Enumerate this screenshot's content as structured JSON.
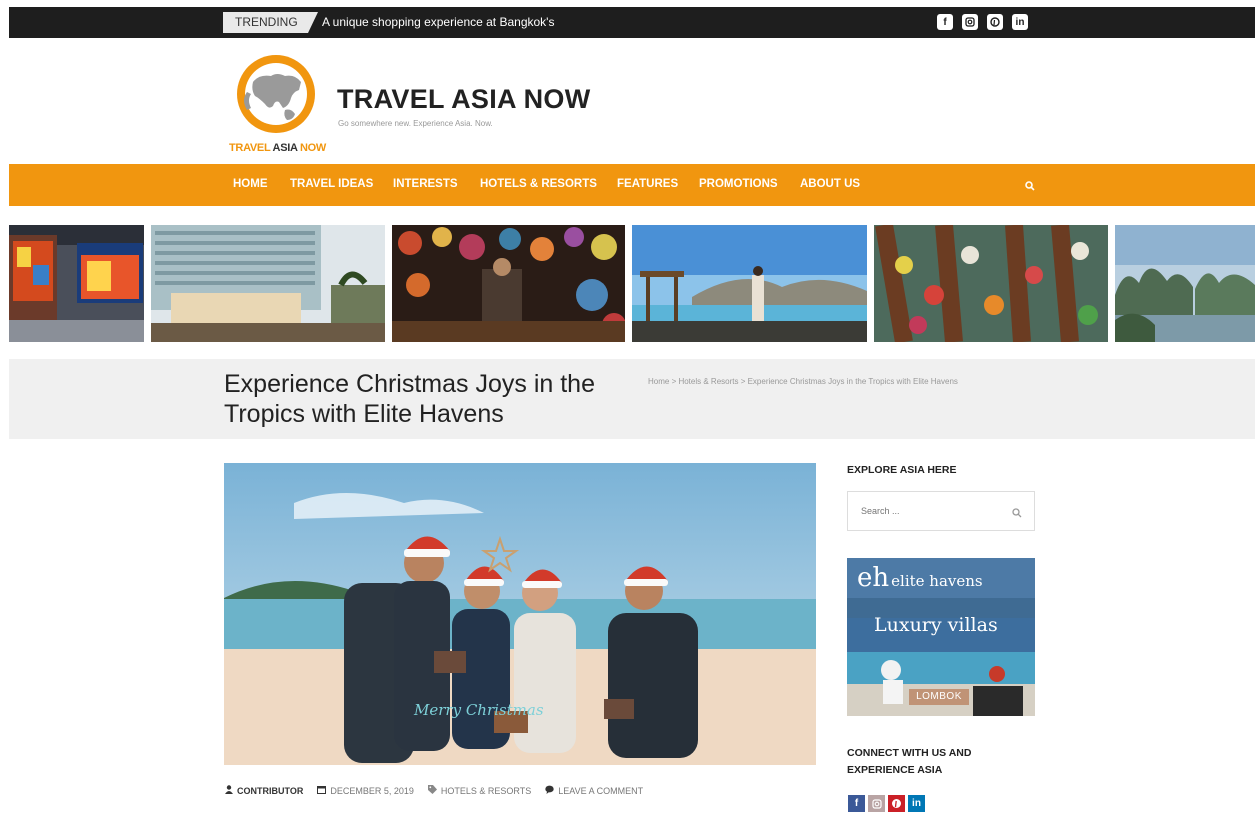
{
  "topbar": {
    "trending_label": "TRENDING",
    "trending_text": "A unique shopping experience at Bangkok's",
    "social_icons": [
      "facebook-icon",
      "instagram-icon",
      "pinterest-icon",
      "linkedin-icon"
    ]
  },
  "header": {
    "logo_text_1": "TRAVEL ",
    "logo_text_2": "ASIA ",
    "logo_text_3": "NOW",
    "title": "TRAVEL ASIA NOW",
    "tagline": "Go somewhere new. Experience Asia. Now."
  },
  "nav": {
    "items": [
      "HOME",
      "TRAVEL IDEAS",
      "INTERESTS",
      "HOTELS & RESORTS",
      "FEATURES",
      "PROMOTIONS",
      "ABOUT US"
    ]
  },
  "post": {
    "title": "Experience Christmas Joys in the Tropics with Elite Havens",
    "breadcrumb": "Home > Hotels & Resorts > Experience Christmas Joys in the Tropics with Elite Havens",
    "author": "CONTRIBUTOR",
    "date": "DECEMBER 5, 2019",
    "category": "HOTELS & RESORTS",
    "comment": "LEAVE A COMMENT",
    "image_caption_text": "Merry Christmas"
  },
  "sidebar": {
    "explore_heading": "EXPLORE ASIA HERE",
    "search_placeholder": "Search ...",
    "ad_logo": "eh",
    "ad_brand": "elite havens",
    "ad_headline": "Luxury villas",
    "ad_location": "LOMBOK",
    "connect_heading_1": "CONNECT WITH US AND",
    "connect_heading_2": "EXPERIENCE ASIA"
  },
  "colors": {
    "accent": "#f1960f",
    "topbar": "#1e1e1e",
    "facebook": "#3b5998",
    "instagram": "#b9a4a4",
    "pinterest": "#cb2027",
    "linkedin": "#0077b5"
  }
}
